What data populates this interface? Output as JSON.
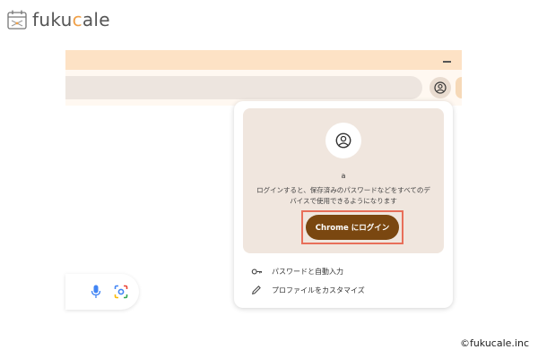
{
  "logo": {
    "prefix": "fuku",
    "accent": "c",
    "suffix": "ale"
  },
  "browser": {
    "profile_button_icon": "account-circle-icon"
  },
  "search": {
    "mic_icon": "mic-icon",
    "lens_icon": "google-lens-icon"
  },
  "popup": {
    "avatar_icon": "account-circle-icon",
    "profile_name": "a",
    "description": "ログインすると、保存済みのパスワードなどをすべてのデバイスで使用できるようになります",
    "signin_button": "Chrome にログイン",
    "menu": [
      {
        "icon": "key-icon",
        "label": "パスワードと自動入力"
      },
      {
        "icon": "pencil-icon",
        "label": "プロファイルをカスタマイズ"
      }
    ]
  },
  "copyright": "©fukucale.inc",
  "colors": {
    "titlebar": "#fde2c5",
    "accent_orange": "#f0a048",
    "signin_button_bg": "#7a4710",
    "highlight_border": "#e86f5a",
    "popup_card_bg": "#f0e6de"
  }
}
